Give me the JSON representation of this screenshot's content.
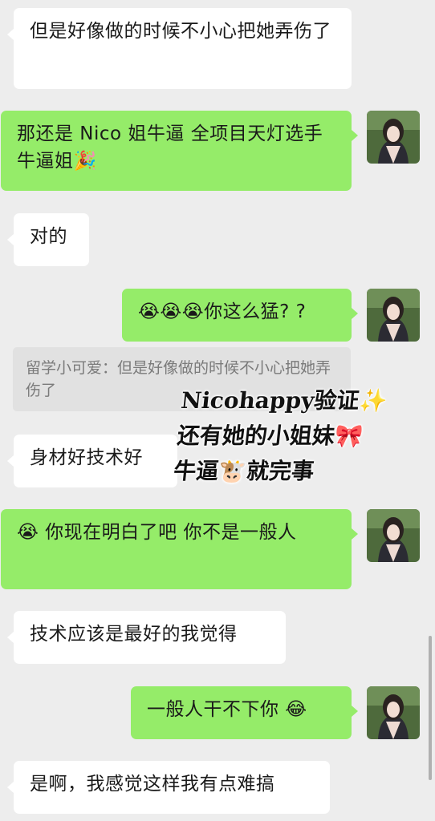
{
  "messages": [
    {
      "side": "left",
      "text": "但是好像做的时候不小心把她弄伤了"
    },
    {
      "side": "right",
      "text": "那还是 Nico 姐牛逼 全项目天灯选手 牛逼姐🎉"
    },
    {
      "side": "left",
      "text": "对的"
    },
    {
      "side": "right",
      "text": "😭😭😭你这么猛? ?"
    },
    {
      "side": "left",
      "text": "身材好技术好"
    },
    {
      "side": "right",
      "text": "😭 你现在明白了吧 你不是一般人"
    },
    {
      "side": "left",
      "text": "技术应该是最好的我觉得"
    },
    {
      "side": "right",
      "text": "一般人干不下你 😂"
    },
    {
      "side": "left",
      "text": "是啊，我感觉这样我有点难搞"
    }
  ],
  "quote": {
    "text": "留学小可爱：但是好像做的时候不小心把她弄伤了"
  },
  "overlay": {
    "line1": "Nicohappy验证✨",
    "line2": "还有她的小姐妹🎀",
    "line3": "牛逼🐮就完事"
  },
  "colors": {
    "sent": "#95ec69",
    "received": "#ffffff",
    "background": "#ededed"
  }
}
